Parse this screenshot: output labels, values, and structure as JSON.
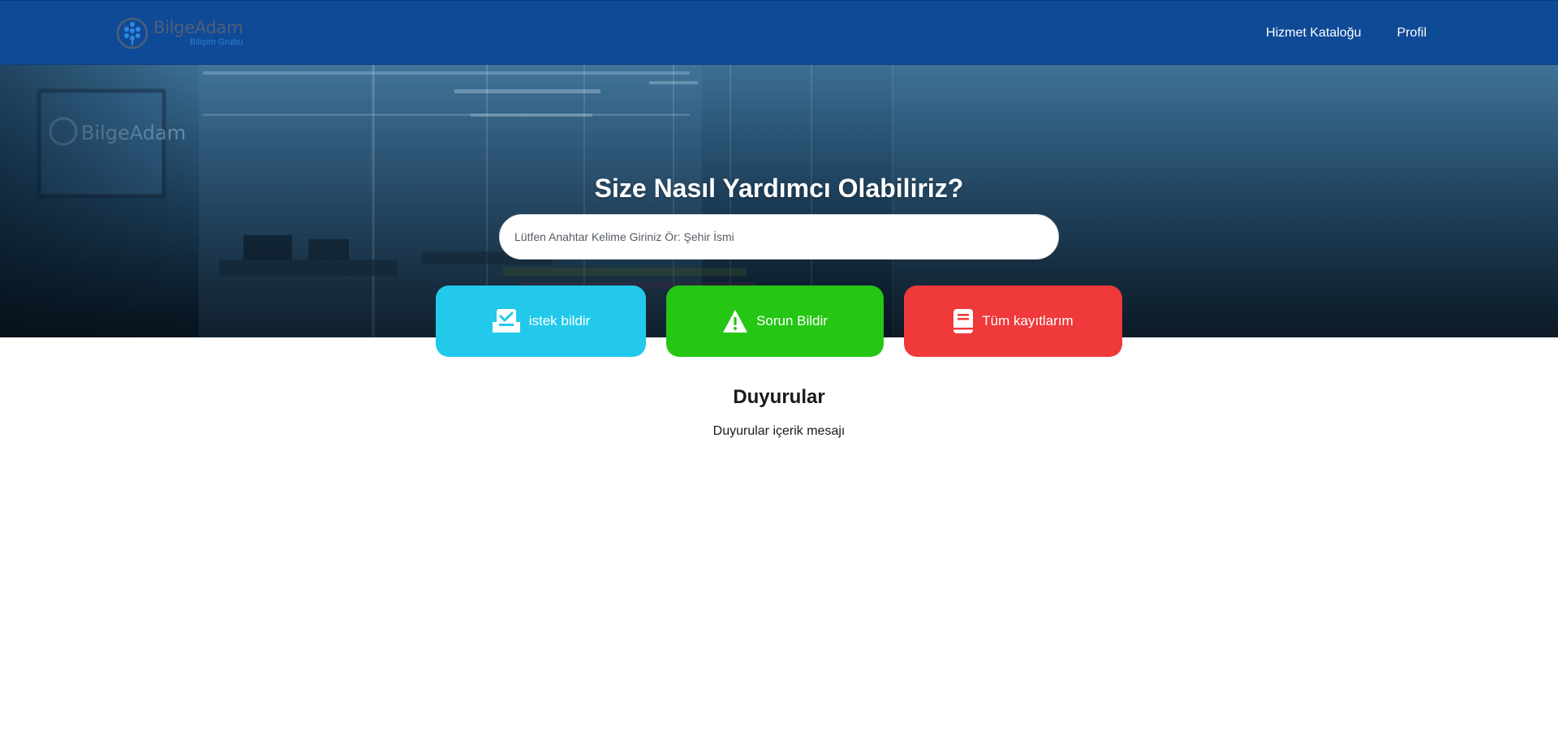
{
  "header": {
    "brand_name": "BilgeAdam",
    "brand_sub": "Bilişim Grubu",
    "nav": [
      {
        "label": "Hizmet Kataloğu"
      },
      {
        "label": "Profil"
      }
    ]
  },
  "hero": {
    "title": "Size Nasıl Yardımcı Olabiliriz?",
    "search_placeholder": "Lütfen Anahtar Kelime Giriniz Ör: Şehir İsmi",
    "search_value": ""
  },
  "actions": [
    {
      "label": "istek bildir",
      "icon": "inbox-check-icon",
      "color": "#22c9ea"
    },
    {
      "label": "Sorun Bildir",
      "icon": "warning-icon",
      "color": "#26c615"
    },
    {
      "label": "Tüm kayıtlarım",
      "icon": "book-icon",
      "color": "#ef393a"
    }
  ],
  "announcements": {
    "title": "Duyurular",
    "message": "Duyurular içerik mesajı"
  },
  "colors": {
    "header_bg": "#0f4a97",
    "request_button": "#22c9ea",
    "issue_button": "#26c615",
    "records_button": "#ef393a"
  }
}
